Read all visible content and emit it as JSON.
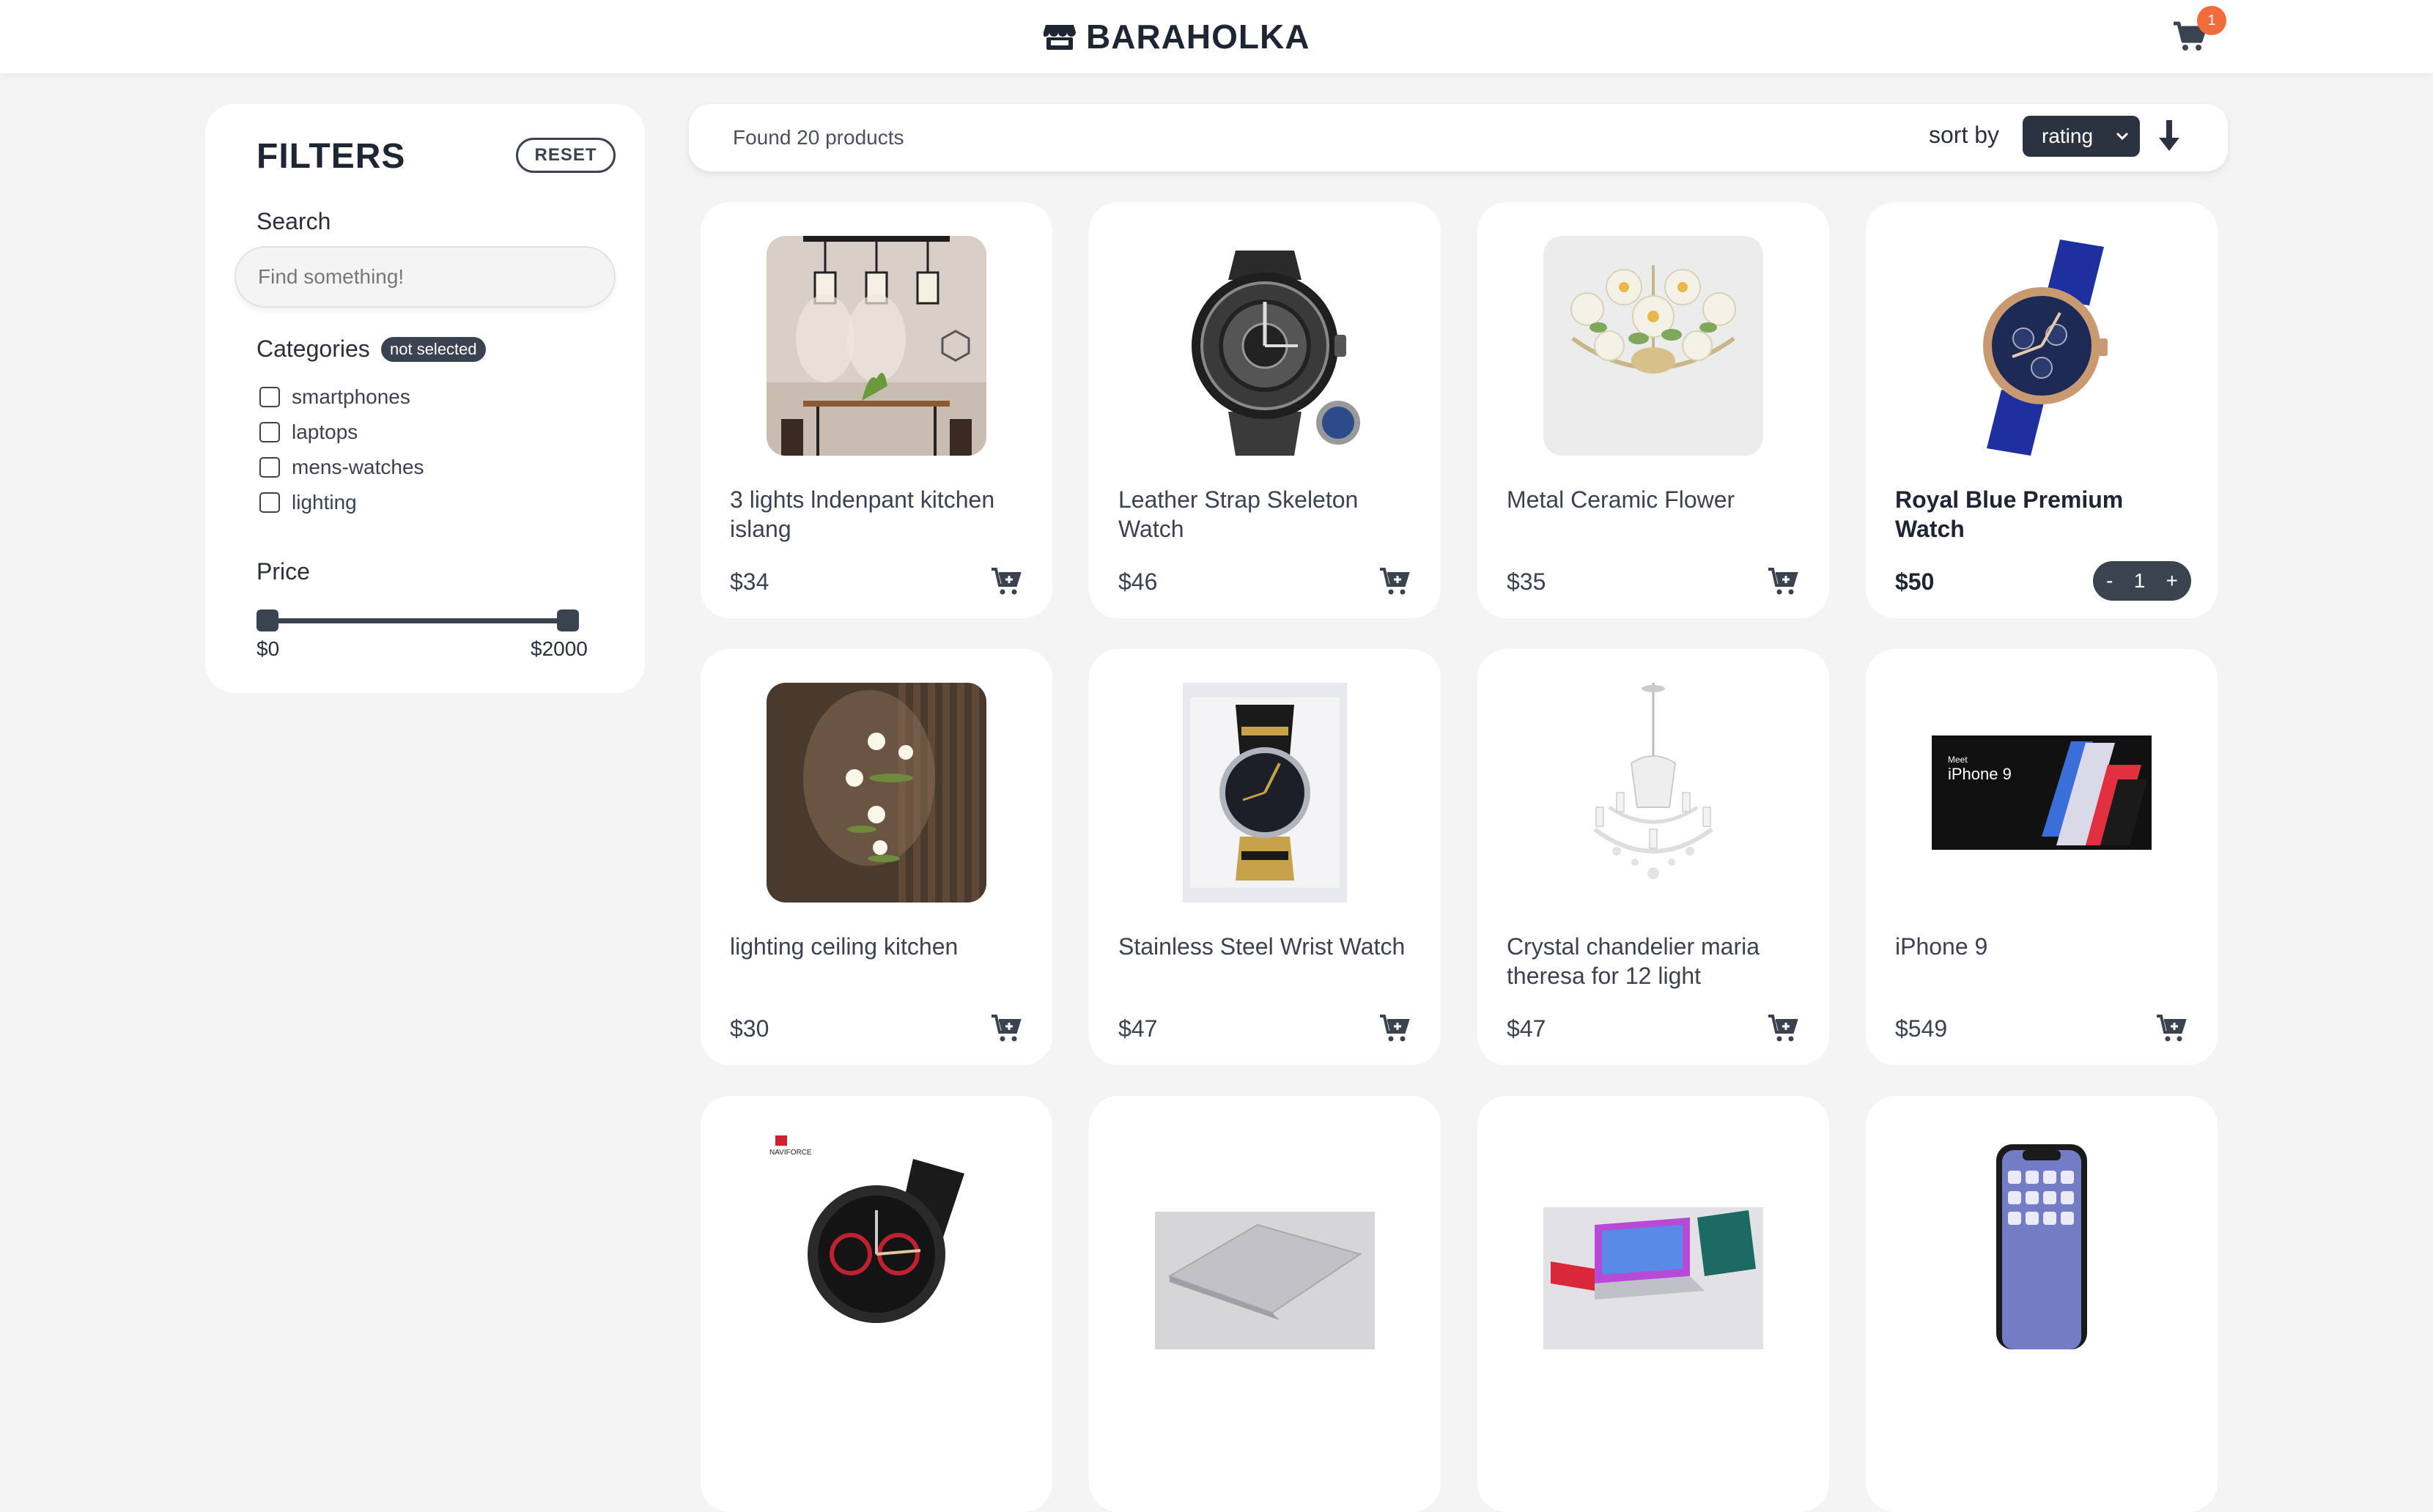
{
  "header": {
    "brand": "BARAHOLKA",
    "cart_count": "1"
  },
  "filters": {
    "title": "FILTERS",
    "reset_label": "RESET",
    "search_label": "Search",
    "search_placeholder": "Find something!",
    "categories_label": "Categories",
    "categories_badge": "not selected",
    "categories": [
      "smartphones",
      "laptops",
      "mens-watches",
      "lighting"
    ],
    "price_label": "Price",
    "price_min": "$0",
    "price_max": "$2000"
  },
  "toolbar": {
    "found_text": "Found 20 products",
    "sort_label": "sort by",
    "sort_value": "rating"
  },
  "products": [
    {
      "title": "3 lights lndenpant kitchen islang",
      "price": "$34",
      "icon": "pendant-lights-image"
    },
    {
      "title": "Leather Strap Skeleton Watch",
      "price": "$46",
      "icon": "skeleton-watch-image"
    },
    {
      "title": "Metal Ceramic Flower",
      "price": "$35",
      "icon": "ceramic-flower-chandelier-image"
    },
    {
      "title": "Royal Blue Premium Watch",
      "price": "$50",
      "icon": "blue-watch-image",
      "in_cart": true,
      "quantity": "1"
    },
    {
      "title": "lighting ceiling kitchen",
      "price": "$30",
      "icon": "ceiling-lights-image"
    },
    {
      "title": "Stainless Steel Wrist Watch",
      "price": "$47",
      "icon": "wrist-watch-box-image"
    },
    {
      "title": "Crystal chandelier maria theresa for 12 light",
      "price": "$47",
      "icon": "crystal-chandelier-image"
    },
    {
      "title": "iPhone 9",
      "price": "$549",
      "icon": "iphone-9-image",
      "image_text_small": "Meet",
      "image_text": "iPhone 9"
    },
    {
      "title": "",
      "price": "",
      "icon": "naviforce-watch-image",
      "image_text": "NAVIFORCE"
    },
    {
      "title": "",
      "price": "",
      "icon": "silver-laptop-image"
    },
    {
      "title": "",
      "price": "",
      "icon": "laptops-image"
    },
    {
      "title": "",
      "price": "",
      "icon": "iphone-x-image"
    }
  ],
  "colors": {
    "accent": "#3c4350",
    "badge": "#f26b3a",
    "background": "#f4f4f4"
  }
}
